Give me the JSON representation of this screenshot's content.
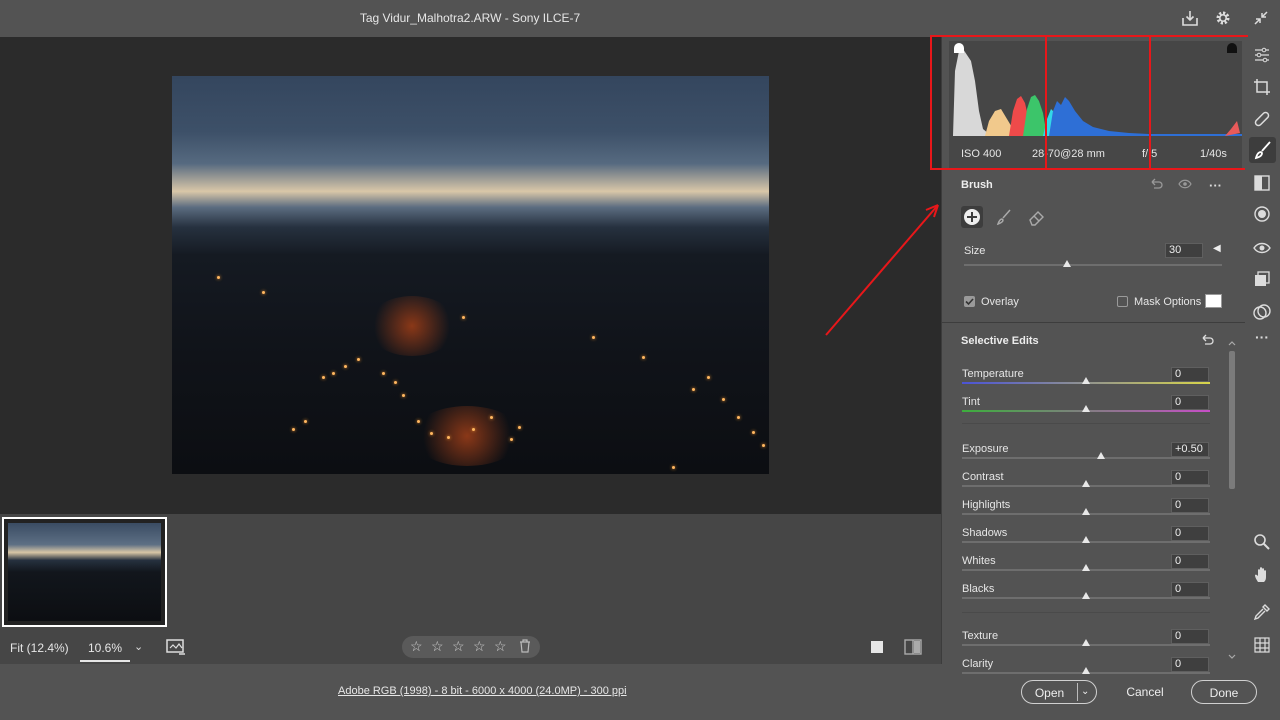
{
  "window": {
    "title": "Tag Vidur_Malhotra2.ARW  -  Sony ILCE-7"
  },
  "histogram": {
    "iso": "ISO 400",
    "lens": "28-70@28 mm",
    "aperture": "f/.5",
    "shutter": "1/40s"
  },
  "brush": {
    "title": "Brush",
    "size_label": "Size",
    "size_value": "30",
    "size_level": 0.4,
    "overlay_label": "Overlay",
    "overlay_checked": true,
    "mask_options_label": "Mask Options",
    "mask_options_checked": false
  },
  "selective": {
    "title": "Selective Edits",
    "sliders": [
      {
        "label": "Temperature",
        "value": "0"
      },
      {
        "label": "Tint",
        "value": "0"
      },
      {
        "label": "Exposure",
        "value": "+0.50"
      },
      {
        "label": "Contrast",
        "value": "0"
      },
      {
        "label": "Highlights",
        "value": "0"
      },
      {
        "label": "Shadows",
        "value": "0"
      },
      {
        "label": "Whites",
        "value": "0"
      },
      {
        "label": "Blacks",
        "value": "0"
      },
      {
        "label": "Texture",
        "value": "0"
      },
      {
        "label": "Clarity",
        "value": "0"
      }
    ]
  },
  "bottom": {
    "fit": "Fit (12.4%)",
    "zoom": "10.6%"
  },
  "footer": {
    "info": "Adobe RGB (1998) - 8 bit - 6000 x 4000 (24.0MP) - 300 ppi",
    "open": "Open",
    "cancel": "Cancel",
    "done": "Done"
  },
  "colors": {
    "accent": "#e8171a",
    "panel": "#535353",
    "canvas": "#2b2b2b"
  }
}
